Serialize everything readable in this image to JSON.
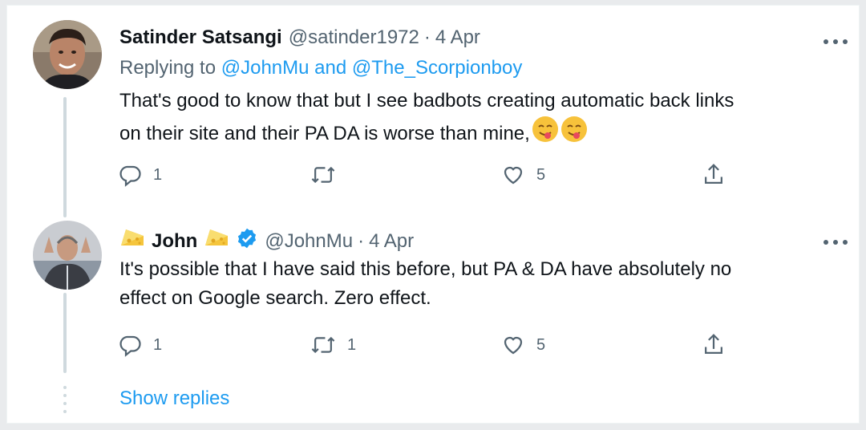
{
  "tweets": [
    {
      "name": "Satinder Satsangi",
      "handle": "@satinder1972",
      "separator": "·",
      "date": "4 Apr",
      "replying_prefix": "Replying to",
      "replying_mentions": "@JohnMu and @The_Scorpionboy",
      "text_line1": "That's good to know that but I see badbots creating automatic back links",
      "text_line2": "on their site and their PA DA is worse than mine,",
      "emoji": [
        "savoring-food-emoji",
        "savoring-food-emoji"
      ],
      "actions": {
        "reply": "1",
        "retweet": "",
        "like": "5"
      }
    },
    {
      "name": "John",
      "name_emoji": "cheese-emoji",
      "verified": true,
      "handle": "@JohnMu",
      "separator": "·",
      "date": "4 Apr",
      "text_line1": "It's possible that I have said this before, but PA & DA have absolutely no",
      "text_line2": "effect on Google search. Zero effect.",
      "actions": {
        "reply": "1",
        "retweet": "1",
        "like": "5"
      }
    }
  ],
  "show_replies": "Show replies",
  "colors": {
    "link": "#1d9bf0",
    "muted": "#536471",
    "text": "#0f1419",
    "thread": "#cfd9de"
  },
  "icons": [
    "reply-icon",
    "retweet-icon",
    "like-icon",
    "share-icon",
    "more-icon",
    "verified-badge-icon"
  ]
}
